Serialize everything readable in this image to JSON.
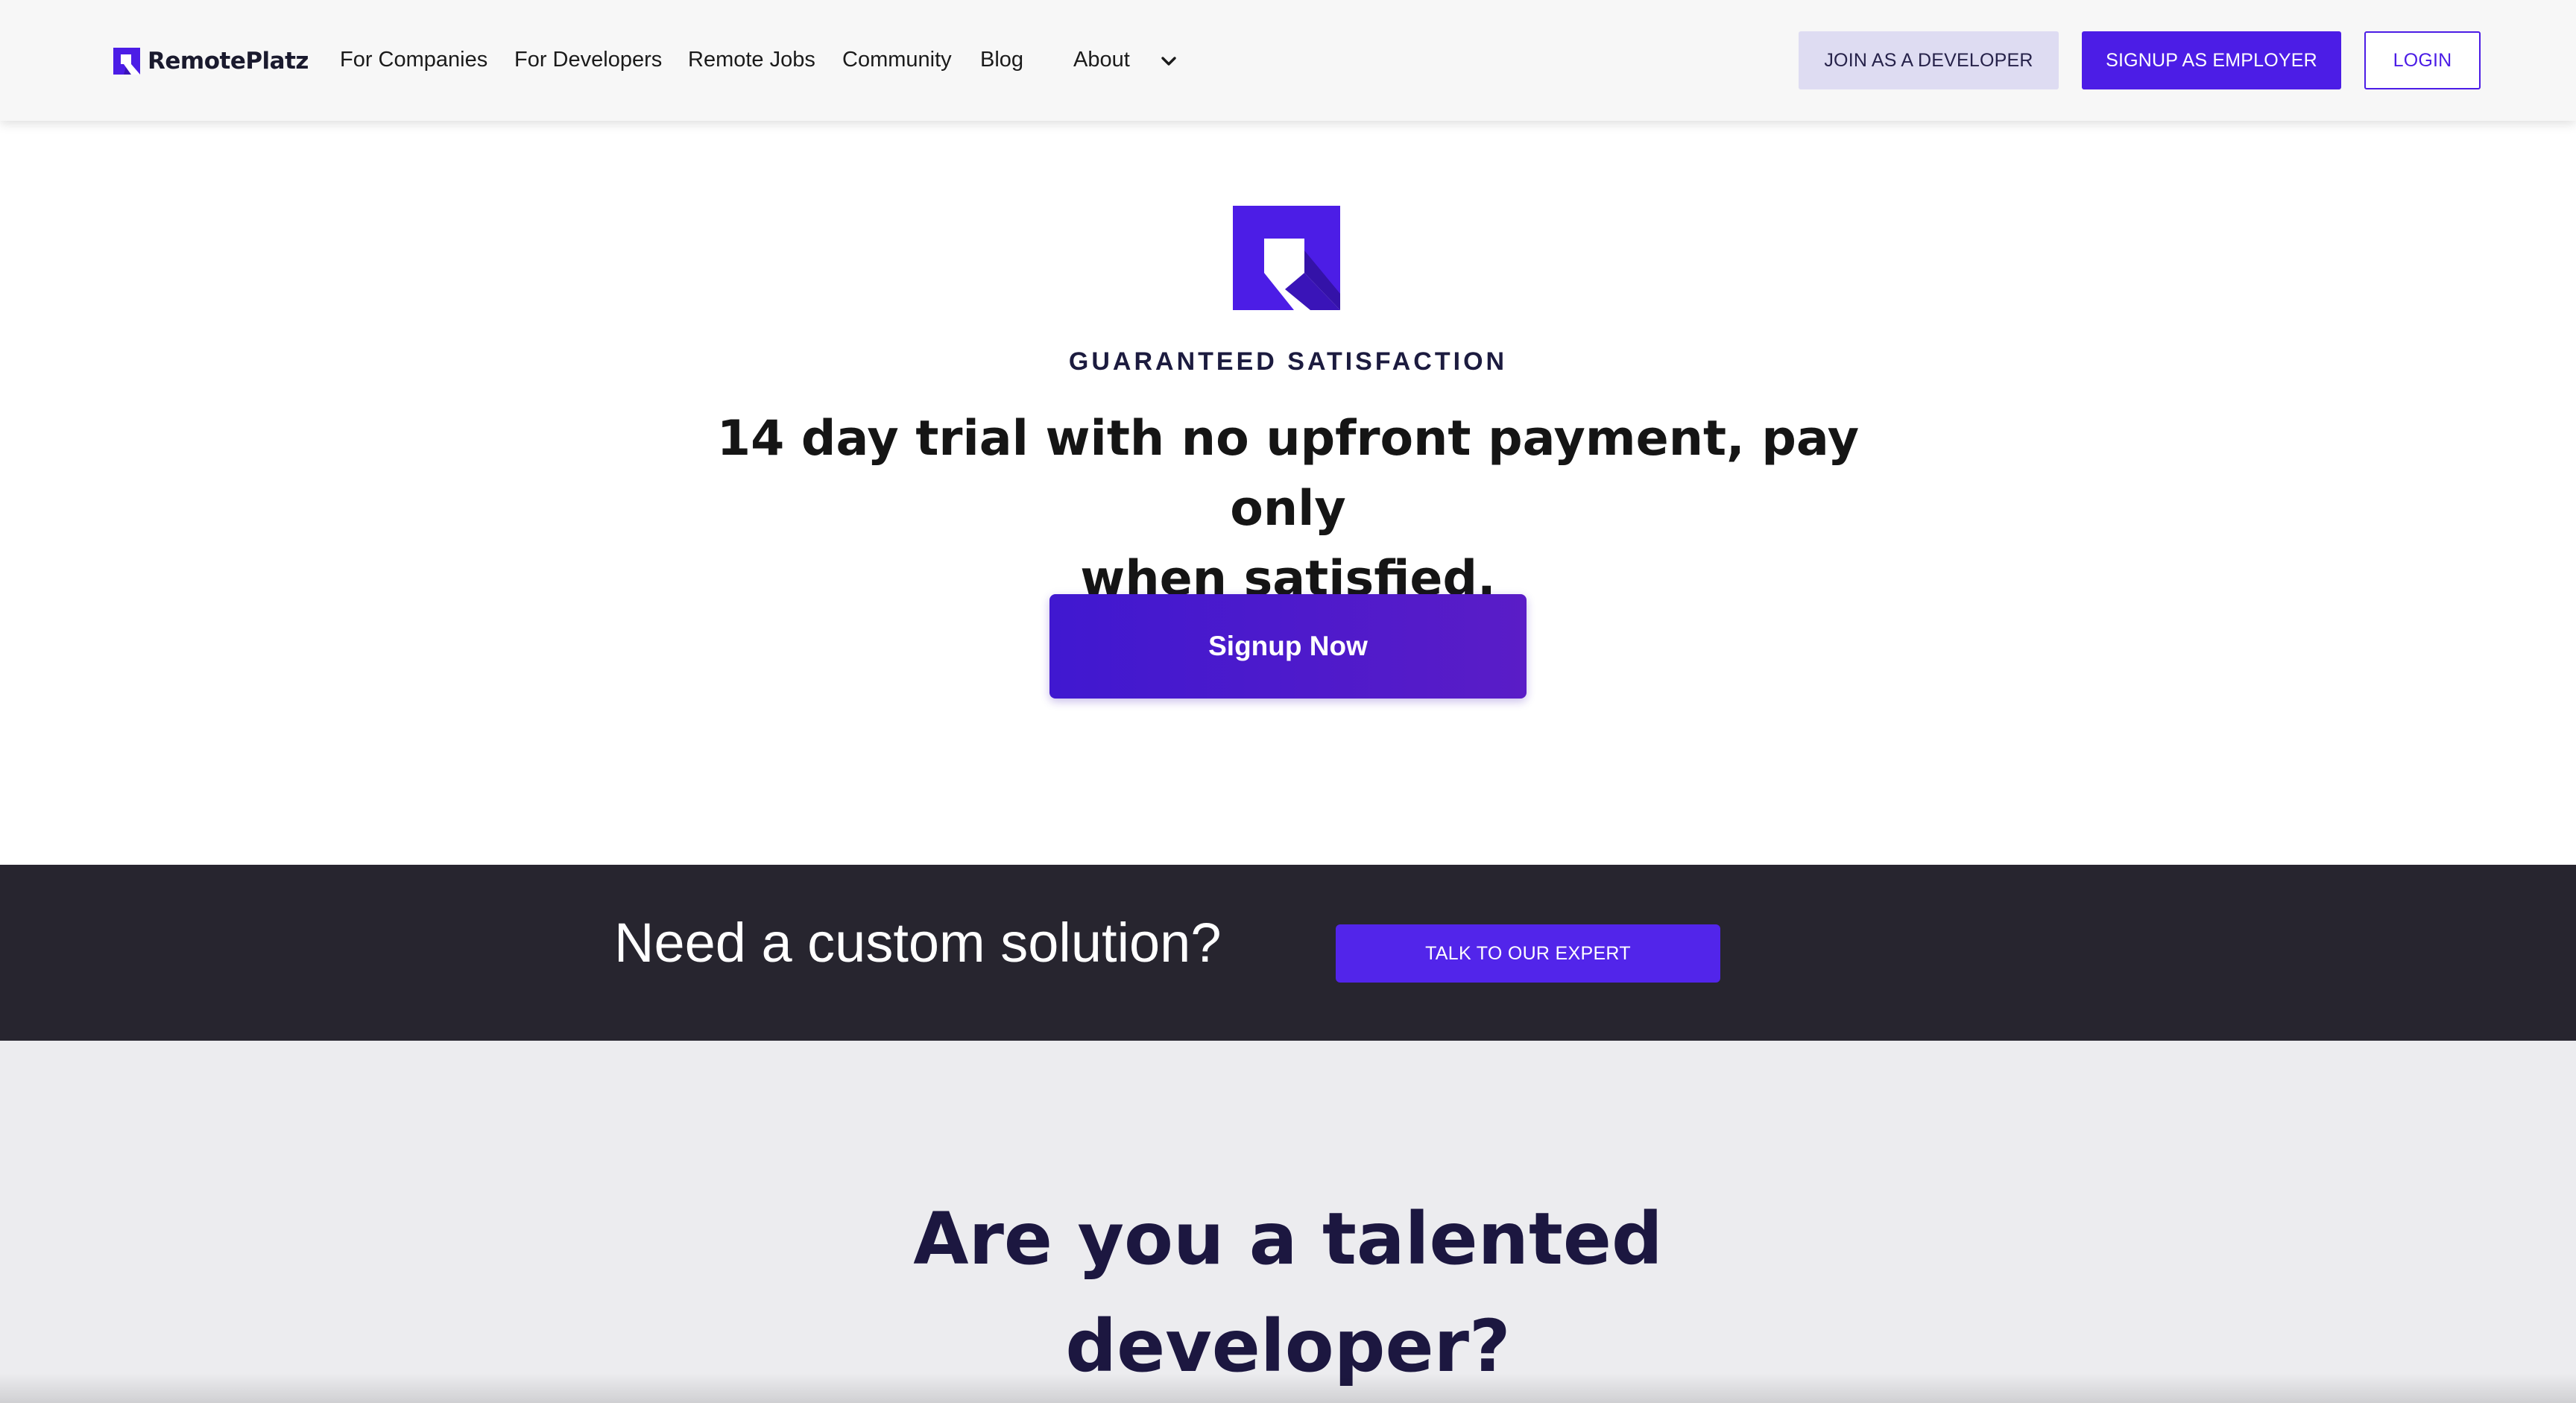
{
  "header": {
    "brand": "RemotePlatz",
    "nav": [
      "For Companies",
      "For Developers",
      "Remote Jobs",
      "Community",
      "Blog",
      "About"
    ],
    "join_developer": "JOIN AS A DEVELOPER",
    "signup_employer": "SIGNUP AS EMPLOYER",
    "login": "LOGIN"
  },
  "hero": {
    "kicker": "GUARANTEED SATISFACTION",
    "headline_line1": "14 day trial with no upfront payment, pay only",
    "headline_line2": "when satisfied.",
    "cta": "Signup Now"
  },
  "custom": {
    "text": "Need a custom solution?",
    "button": "TALK TO OUR EXPERT"
  },
  "developer_section": {
    "title_line1": "Are you a talented",
    "title_line2": "developer?"
  },
  "colors": {
    "accent": "#4c1de6",
    "dark_band": "#27252f",
    "grey_section": "#ececef"
  }
}
